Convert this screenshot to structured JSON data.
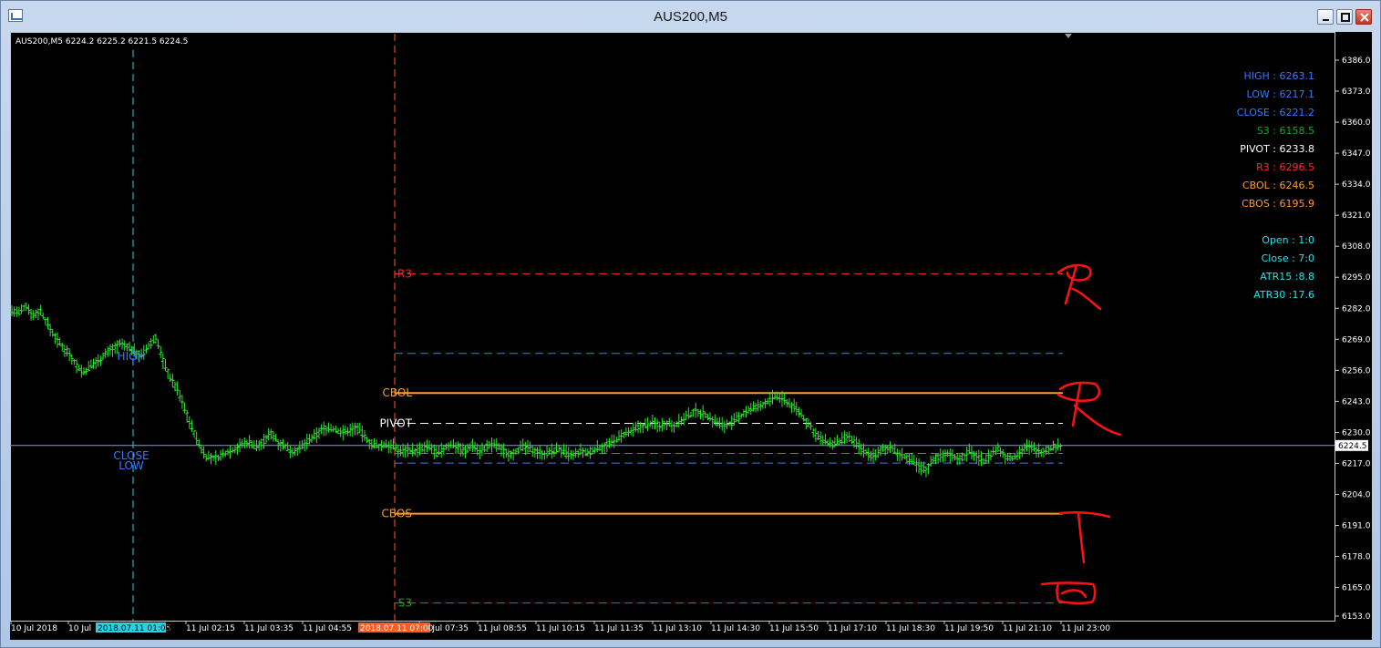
{
  "window": {
    "title": "AUS200,M5"
  },
  "chart_data": {
    "type": "candlestick",
    "symbol_info": "AUS200,M5  6224.2 6225.2 6221.5 6224.5",
    "y_ticks": [
      "6386.0",
      "6373.0",
      "6360.0",
      "6347.0",
      "6334.0",
      "6321.0",
      "6308.0",
      "6295.0",
      "6282.0",
      "6269.0",
      "6256.0",
      "6243.0",
      "6230.0",
      "6217.0",
      "6204.0",
      "6191.0",
      "6178.0",
      "6165.0",
      "6153.0"
    ],
    "x_ticks": [
      "10 Jul 2018",
      "10 Jul",
      "11 Jul 02:15",
      "11 Jul 03:35",
      "11 Jul 04:55",
      "11 Jul 07:35",
      "11 Jul 08:55",
      "11 Jul 10:15",
      "11 Jul 11:35",
      "11 Jul 13:10",
      "11 Jul 14:30",
      "11 Jul 15:50",
      "11 Jul 17:10",
      "11 Jul 18:30",
      "11 Jul 19:50",
      "11 Jul 21:10",
      "11 Jul 23:00"
    ],
    "x_tick_suffix": "5",
    "cursor_labels": {
      "left": "2018.07.11 01:00",
      "right": "2018.07.11 07:00"
    },
    "current_price": "6224.5",
    "bid_line_value": 6224.5,
    "levels": [
      {
        "label": "R3",
        "value": 6296.5,
        "color": "#ff2a2a",
        "style": "dash"
      },
      {
        "label": "",
        "value": 6263.1,
        "color": "#3a78ff",
        "style": "dash"
      },
      {
        "label": "CBOL",
        "value": 6246.5,
        "color": "#ff9a2e",
        "style": "solid"
      },
      {
        "label": "PIVOT",
        "value": 6233.8,
        "color": "#ffffff",
        "style": "dash"
      },
      {
        "label": "",
        "value": 6221.2,
        "color": "#3a78ff",
        "style": "dash"
      },
      {
        "label": "",
        "value": 6217.1,
        "color": "#3a78ff",
        "style": "dash"
      },
      {
        "label": "CBOS",
        "value": 6195.9,
        "color": "#ff9a2e",
        "style": "solid"
      },
      {
        "label": "S3",
        "value": 6158.5,
        "color": "#1fa31f",
        "style": "dash"
      }
    ],
    "prev_day_labels": [
      "HIGH",
      "CLOSE",
      "LOW"
    ],
    "series": [
      {
        "name": "price",
        "values": [
          6281,
          6280,
          6283,
          6279,
          6281,
          6275,
          6270,
          6266,
          6263,
          6258,
          6255,
          6258,
          6260,
          6263,
          6265,
          6267,
          6266,
          6264,
          6262,
          6266,
          6270,
          6260,
          6253,
          6248,
          6240,
          6232,
          6225,
          6220,
          6219,
          6220,
          6222,
          6223,
          6225,
          6226,
          6224,
          6226,
          6230,
          6226,
          6224,
          6222,
          6223,
          6226,
          6228,
          6231,
          6232,
          6231,
          6230,
          6231,
          6232,
          6228,
          6225,
          6224,
          6225,
          6224,
          6222,
          6223,
          6222,
          6223,
          6224,
          6221,
          6223,
          6225,
          6224,
          6222,
          6225,
          6222,
          6224,
          6225,
          6223,
          6221,
          6222,
          6224,
          6223,
          6222,
          6221,
          6222,
          6223,
          6221,
          6220,
          6222,
          6221,
          6223,
          6224,
          6225,
          6227,
          6229,
          6230,
          6232,
          6233,
          6234,
          6233,
          6234,
          6233,
          6235,
          6237,
          6239,
          6238,
          6236,
          6234,
          6233,
          6234,
          6236,
          6239,
          6240,
          6241,
          6243,
          6245,
          6244,
          6242,
          6240,
          6236,
          6232,
          6228,
          6226,
          6225,
          6226,
          6228,
          6226,
          6223,
          6221,
          6220,
          6223,
          6224,
          6221,
          6220,
          6218,
          6216,
          6214,
          6219,
          6220,
          6221,
          6220,
          6219,
          6222,
          6220,
          6218,
          6221,
          6223,
          6220,
          6219,
          6222,
          6224,
          6223,
          6222,
          6223,
          6224,
          6224.5
        ]
      }
    ]
  },
  "info_panel": {
    "items": [
      {
        "text": "HIGH : 6263.1",
        "color": "#3a78ff"
      },
      {
        "text": "LOW : 6217.1",
        "color": "#3a78ff"
      },
      {
        "text": "CLOSE : 6221.2",
        "color": "#3a78ff"
      },
      {
        "text": "S3 : 6158.5",
        "color": "#1fa31f"
      },
      {
        "text": "PIVOT : 6233.8",
        "color": "#ffffff"
      },
      {
        "text": "R3 : 6296.5",
        "color": "#ff2a2a"
      },
      {
        "text": "CBOL : 6246.5",
        "color": "#ff9a2e"
      },
      {
        "text": "CBOS : 6195.9",
        "color": "#ff9a2e"
      }
    ],
    "stats": [
      {
        "text": "Open : 1:0",
        "color": "#22e4ef"
      },
      {
        "text": "Close : 7:0",
        "color": "#22e4ef"
      },
      {
        "text": "ATR15 :8.8",
        "color": "#22e4ef"
      },
      {
        "text": "ATR30 :17.6",
        "color": "#22e4ef"
      }
    ]
  },
  "colors": {
    "background": "#000000",
    "candle": "#2ee82e",
    "axis_text": "#ffffff",
    "annotation": "#ff1111",
    "vline_left": "#22d4e6",
    "vline_right": "#ff5a1f"
  }
}
